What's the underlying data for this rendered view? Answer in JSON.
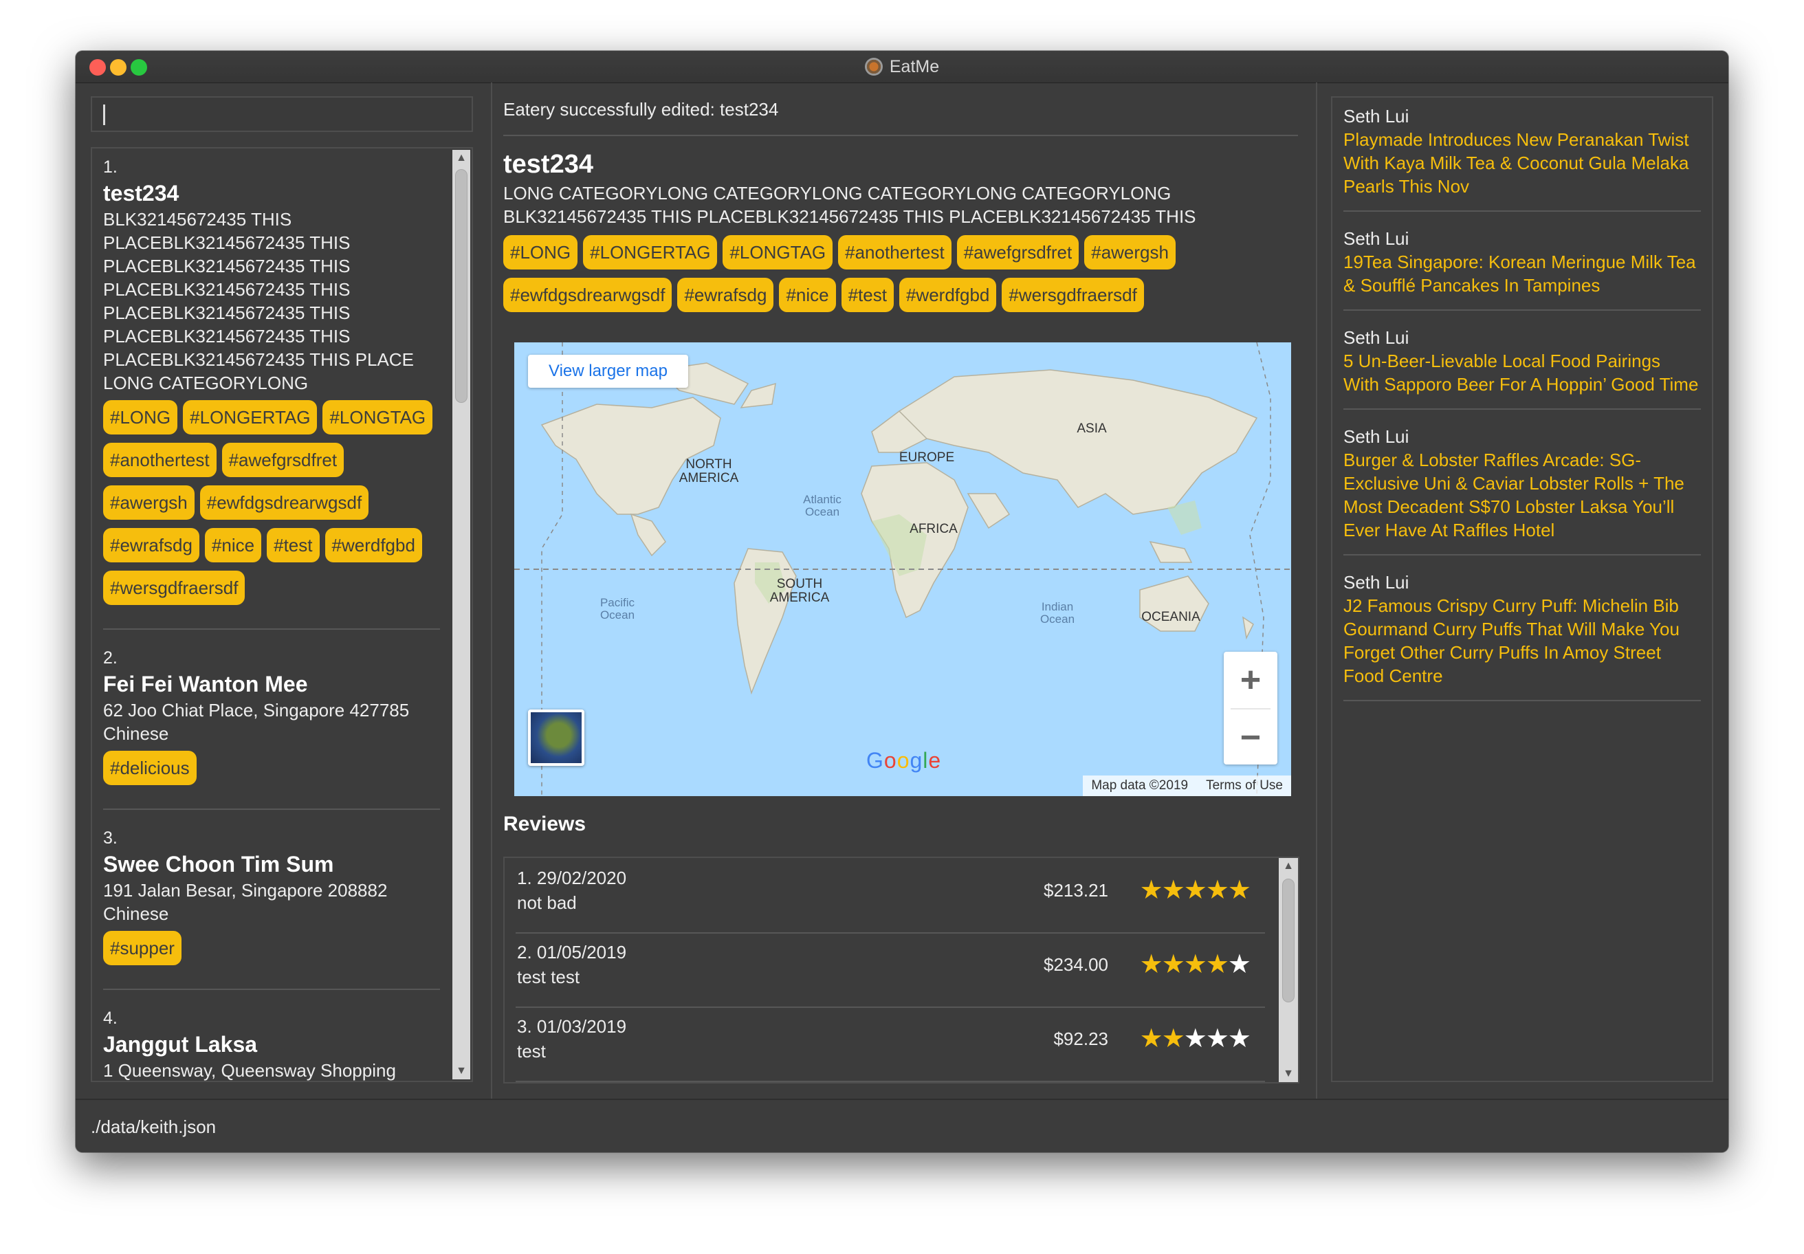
{
  "window": {
    "title": "EatMe"
  },
  "command": {
    "value": ""
  },
  "list": [
    {
      "index": "1.",
      "name": "test234",
      "lines": [
        "BLK32145672435 THIS",
        "PLACEBLK32145672435 THIS",
        "PLACEBLK32145672435 THIS",
        "PLACEBLK32145672435 THIS",
        "PLACEBLK32145672435 THIS",
        "PLACEBLK32145672435 THIS",
        "PLACEBLK32145672435 THIS PLACE",
        "LONG CATEGORYLONG"
      ],
      "tags": [
        "#LONG",
        "#LONGERTAG",
        "#LONGTAG",
        "#anothertest",
        "#awefgrsdfret",
        "#awergsh",
        "#ewfdgsdrearwgsdf",
        "#ewrafsdg",
        "#nice",
        "#test",
        "#werdfgbd",
        "#wersgdfraersdf"
      ]
    },
    {
      "index": "2.",
      "name": "Fei Fei Wanton Mee",
      "lines": [
        "62 Joo Chiat Place, Singapore 427785",
        "Chinese"
      ],
      "tags": [
        "#delicious"
      ]
    },
    {
      "index": "3.",
      "name": "Swee Choon Tim Sum",
      "lines": [
        "191 Jalan Besar, Singapore 208882",
        "Chinese"
      ],
      "tags": [
        "#supper"
      ]
    },
    {
      "index": "4.",
      "name": "Janggut Laksa",
      "lines": [
        "1 Queensway, Queensway Shopping"
      ],
      "tags": []
    }
  ],
  "status": {
    "message": "Eatery successfully edited: test234"
  },
  "detail": {
    "name": "test234",
    "category": "LONG CATEGORYLONG CATEGORYLONG CATEGORYLONG CATEGORYLONG",
    "address": "BLK32145672435 THIS PLACEBLK32145672435 THIS PLACEBLK32145672435 THIS",
    "tags": [
      "#LONG",
      "#LONGERTAG",
      "#LONGTAG",
      "#anothertest",
      "#awefgrsdfret",
      "#awergsh",
      "#ewfdgsdrearwgsdf",
      "#ewrafsdg",
      "#nice",
      "#test",
      "#werdfgbd",
      "#wersgdfraersdf"
    ]
  },
  "map": {
    "view_larger": "View larger map",
    "zoom_in": "+",
    "zoom_out": "−",
    "logo": "Google",
    "map_data": "Map data ©2019",
    "terms": "Terms of Use",
    "labels": [
      "NORTH AMERICA",
      "EUROPE",
      "ASIA",
      "AFRICA",
      "SOUTH AMERICA",
      "OCEANIA"
    ],
    "oceans": [
      "Atlantic Ocean",
      "Pacific Ocean",
      "Indian Ocean"
    ]
  },
  "reviews": {
    "heading": "Reviews",
    "items": [
      {
        "line1": "1. 29/02/2020",
        "line2": "not bad",
        "price": "$213.21",
        "rating": 5
      },
      {
        "line1": "2. 01/05/2019",
        "line2": "test test",
        "price": "$234.00",
        "rating": 4
      },
      {
        "line1": "3. 01/03/2019",
        "line2": "test",
        "price": "$92.23",
        "rating": 2
      }
    ]
  },
  "news": [
    {
      "author": "Seth Lui",
      "headline": "Playmade Introduces New Peranakan Twist With Kaya Milk Tea & Coconut Gula Melaka Pearls This Nov"
    },
    {
      "author": "Seth Lui",
      "headline": "19Tea Singapore: Korean Meringue Milk Tea & Soufflé Pancakes In Tampines"
    },
    {
      "author": "Seth Lui",
      "headline": "5 Un-Beer-Lievable Local Food Pairings With Sapporo Beer For A Hoppin’ Good Time"
    },
    {
      "author": "Seth Lui",
      "headline": "Burger & Lobster Raffles Arcade: SG-Exclusive Uni & Caviar Lobster Rolls + The Most Decadent S$70 Lobster Laksa You’ll Ever Have At Raffles Hotel"
    },
    {
      "author": "Seth Lui",
      "headline": "J2 Famous Crispy Curry Puff: Michelin Bib Gourmand Curry Puffs That Will Make You Forget Other Curry Puffs In Amoy Street Food Centre"
    }
  ],
  "footer": {
    "path": "./data/keith.json"
  },
  "colors": {
    "accent": "#f6be0d",
    "background": "#3c3c3c",
    "star_off": "#ffffff"
  }
}
